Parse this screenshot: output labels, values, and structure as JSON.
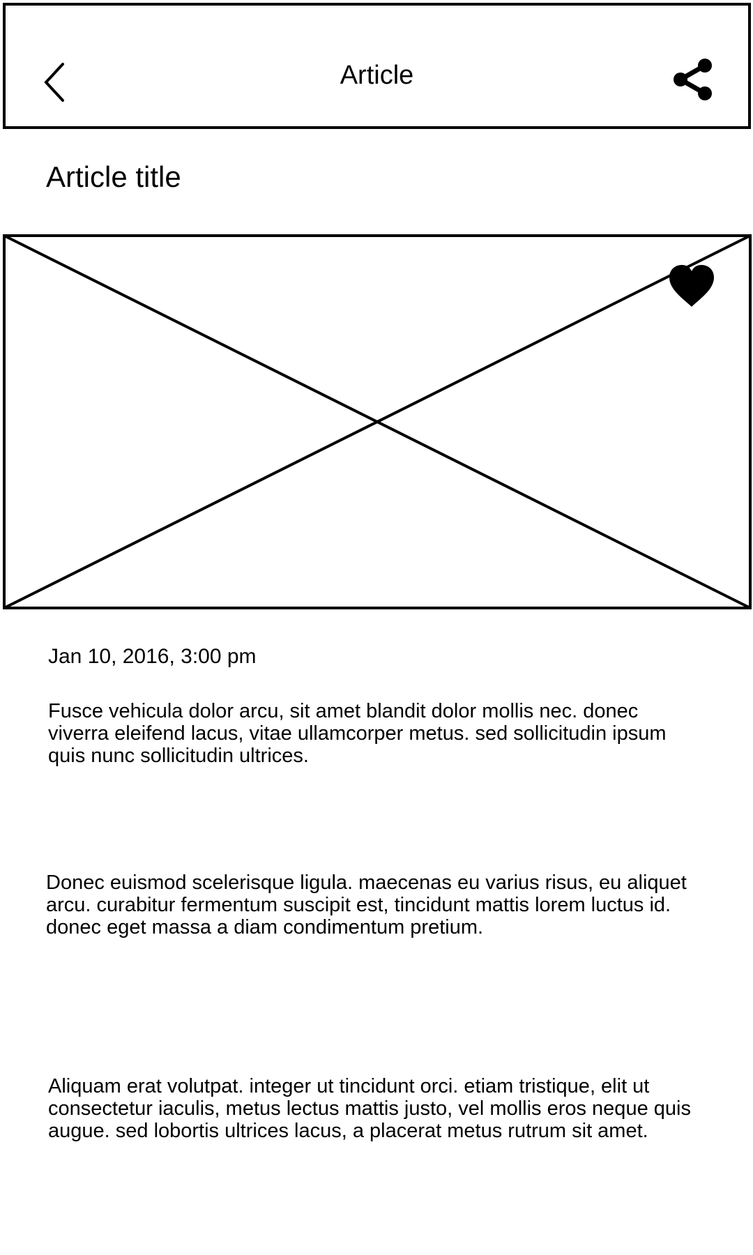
{
  "header": {
    "title": "Article",
    "back_icon": "chevron-left-icon",
    "share_icon": "share-icon"
  },
  "article": {
    "title": "Article title",
    "image_placeholder": "image-placeholder",
    "favorite_icon": "heart-icon",
    "date": "Jan 10, 2016, 3:00 pm",
    "paragraphs": [
      "Fusce vehicula dolor arcu, sit amet blandit dolor mollis nec. donec viverra eleifend lacus, vitae ullamcorper metus. sed sollicitudin ipsum quis nunc sollicitudin ultrices.",
      "Donec euismod scelerisque ligula. maecenas eu varius risus, eu aliquet arcu. curabitur fermentum suscipit est, tincidunt mattis lorem luctus id. donec eget massa a diam condimentum pretium.",
      "Aliquam erat volutpat. integer ut tincidunt orci. etiam tristique, elit ut consectetur iaculis, metus lectus mattis justo, vel mollis eros neque quis augue. sed lobortis ultrices lacus, a placerat metus rutrum sit amet."
    ]
  },
  "colors": {
    "stroke": "#000000",
    "background": "#ffffff"
  }
}
